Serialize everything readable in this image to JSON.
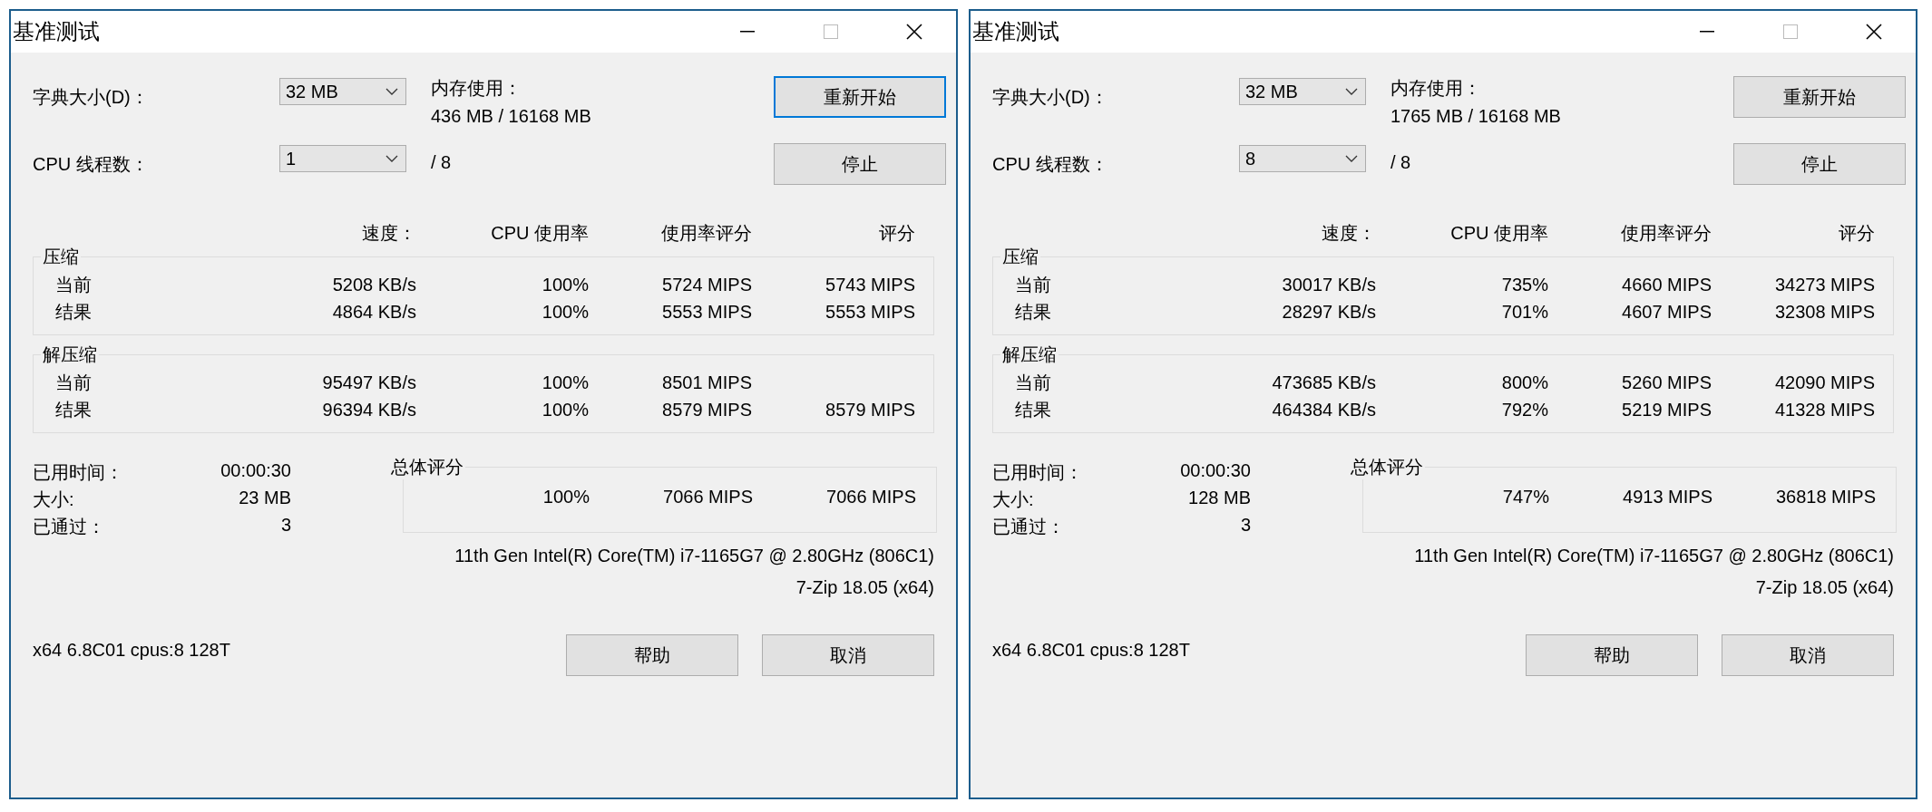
{
  "windows": [
    {
      "title": "基准测试",
      "dictionary": {
        "label": "字典大小(D)：",
        "value": "32 MB"
      },
      "memory": {
        "label": "内存使用：",
        "value": "436 MB / 16168 MB"
      },
      "threads": {
        "label": "CPU 线程数：",
        "value": "1",
        "max": "/ 8"
      },
      "restart": {
        "label": "重新开始",
        "focused": true
      },
      "stop": {
        "label": "停止"
      },
      "columns": [
        "速度：",
        "CPU 使用率",
        "使用率评分",
        "评分"
      ],
      "groups": [
        {
          "title": "压缩",
          "rows": [
            {
              "label": "当前",
              "speed": "5208 KB/s",
              "cpu": "100%",
              "usage_rating": "5724 MIPS",
              "rating": "5743 MIPS"
            },
            {
              "label": "结果",
              "speed": "4864 KB/s",
              "cpu": "100%",
              "usage_rating": "5553 MIPS",
              "rating": "5553 MIPS"
            }
          ]
        },
        {
          "title": "解压缩",
          "rows": [
            {
              "label": "当前",
              "speed": "95497 KB/s",
              "cpu": "100%",
              "usage_rating": "8501 MIPS"
            },
            {
              "label": "结果",
              "speed": "96394 KB/s",
              "cpu": "100%",
              "usage_rating": "8579 MIPS",
              "rating": "8579 MIPS"
            }
          ]
        }
      ],
      "stats": [
        {
          "label": "已用时间：",
          "value": "00:00:30"
        },
        {
          "label": "大小:",
          "value": "23 MB"
        },
        {
          "label": "已通过：",
          "value": "3"
        }
      ],
      "total": {
        "title": "总体评分",
        "cpu": "100%",
        "usage_rating": "7066 MIPS",
        "rating": "7066 MIPS"
      },
      "cpu_name": "11th Gen Intel(R) Core(TM) i7-1165G7 @ 2.80GHz (806C1)",
      "version": "7-Zip 18.05 (x64)",
      "footer": "x64 6.8C01 cpus:8 128T",
      "help": "帮助",
      "cancel": "取消"
    },
    {
      "title": "基准测试",
      "dictionary": {
        "label": "字典大小(D)：",
        "value": "32 MB"
      },
      "memory": {
        "label": "内存使用：",
        "value": "1765 MB / 16168 MB"
      },
      "threads": {
        "label": "CPU 线程数：",
        "value": "8",
        "max": "/ 8"
      },
      "restart": {
        "label": "重新开始",
        "focused": false
      },
      "stop": {
        "label": "停止"
      },
      "columns": [
        "速度：",
        "CPU 使用率",
        "使用率评分",
        "评分"
      ],
      "groups": [
        {
          "title": "压缩",
          "rows": [
            {
              "label": "当前",
              "speed": "30017 KB/s",
              "cpu": "735%",
              "usage_rating": "4660 MIPS",
              "rating": "34273 MIPS"
            },
            {
              "label": "结果",
              "speed": "28297 KB/s",
              "cpu": "701%",
              "usage_rating": "4607 MIPS",
              "rating": "32308 MIPS"
            }
          ]
        },
        {
          "title": "解压缩",
          "rows": [
            {
              "label": "当前",
              "speed": "473685 KB/s",
              "cpu": "800%",
              "usage_rating": "5260 MIPS",
              "rating": "42090 MIPS"
            },
            {
              "label": "结果",
              "speed": "464384 KB/s",
              "cpu": "792%",
              "usage_rating": "5219 MIPS",
              "rating": "41328 MIPS"
            }
          ]
        }
      ],
      "stats": [
        {
          "label": "已用时间：",
          "value": "00:00:30"
        },
        {
          "label": "大小:",
          "value": "128 MB"
        },
        {
          "label": "已通过：",
          "value": "3"
        }
      ],
      "total": {
        "title": "总体评分",
        "cpu": "747%",
        "usage_rating": "4913 MIPS",
        "rating": "36818 MIPS"
      },
      "cpu_name": "11th Gen Intel(R) Core(TM) i7-1165G7 @ 2.80GHz (806C1)",
      "version": "7-Zip 18.05 (x64)",
      "footer": "x64 6.8C01 cpus:8 128T",
      "help": "帮助",
      "cancel": "取消"
    }
  ]
}
